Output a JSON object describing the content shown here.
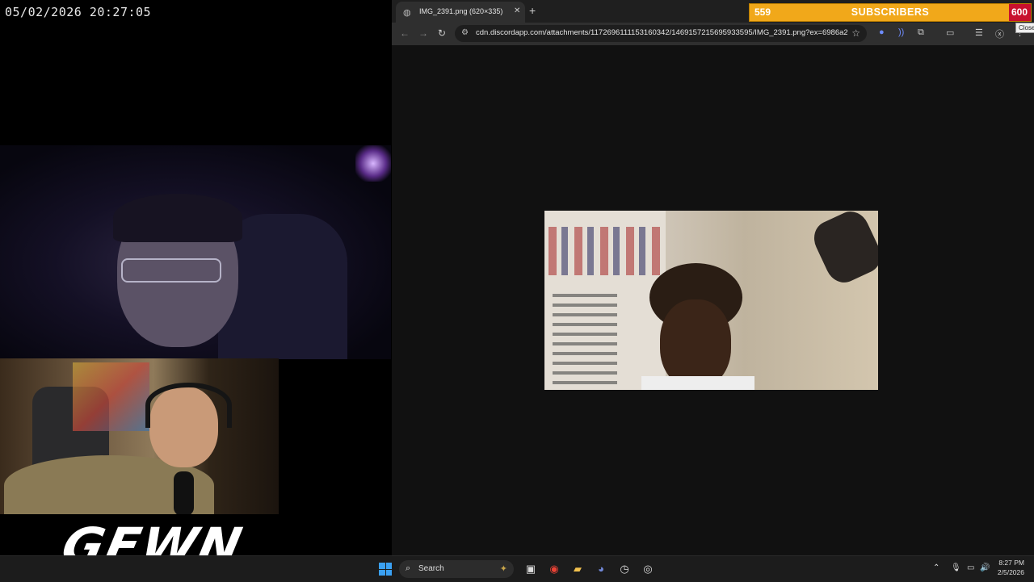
{
  "overlay": {
    "clock": "05/02/2026 20:27:05",
    "logo": "GEWN"
  },
  "browser": {
    "tab_title": "IMG_2391.png (620×335)",
    "new_tab": "+",
    "url": "cdn.discordapp.com/attachments/1172696111153160342/1469157215695933595/IMG_2391.png?ex=6986a2..."
  },
  "subscribers": {
    "current": "559",
    "label": "SUBSCRIBERS",
    "goal": "600",
    "tooltip": "Close"
  },
  "taskbar": {
    "search_label": "Search",
    "time": "8:27 PM",
    "date": "2/5/2026"
  },
  "colors": {
    "subbar": "#f1a81a",
    "goal": "#c8102e",
    "start": "#3aa0f2"
  }
}
